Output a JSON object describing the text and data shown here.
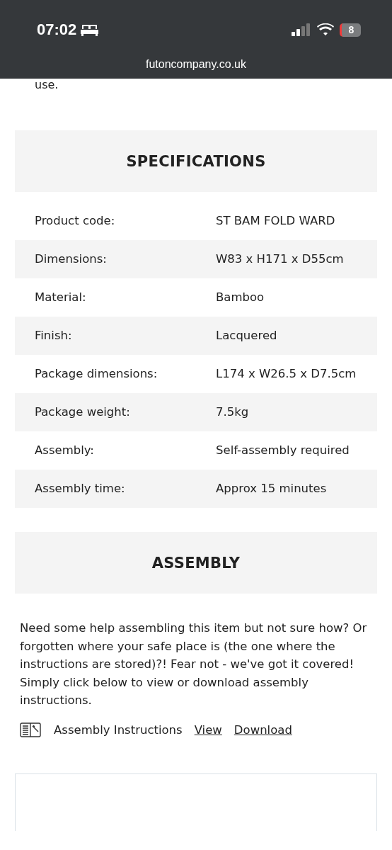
{
  "status_bar": {
    "time": "07:02",
    "battery": "8"
  },
  "address_bar": {
    "url": "futoncompany.co.uk"
  },
  "intro_tail": "use.",
  "specifications": {
    "title": "SPECIFICATIONS",
    "rows": [
      {
        "label": "Product code:",
        "value": "ST BAM FOLD WARD"
      },
      {
        "label": "Dimensions:",
        "value": "W83 x H171 x D55cm"
      },
      {
        "label": "Material:",
        "value": "Bamboo"
      },
      {
        "label": "Finish:",
        "value": "Lacquered"
      },
      {
        "label": "Package dimensions:",
        "value": "L174 x W26.5 x D7.5cm"
      },
      {
        "label": "Package weight:",
        "value": "7.5kg"
      },
      {
        "label": "Assembly:",
        "value": "Self-assembly required"
      },
      {
        "label": "Assembly time:",
        "value": "Approx 15 minutes"
      }
    ]
  },
  "assembly": {
    "title": "ASSEMBLY",
    "text": "Need some help assembling this item but not sure how? Or forgotten where your safe place is (the one where the instructions are stored)?! Fear not - we've got it covered! Simply click below to view or download assembly instructions.",
    "document": {
      "label": "Assembly Instructions",
      "links": [
        "View",
        "Download"
      ]
    }
  }
}
